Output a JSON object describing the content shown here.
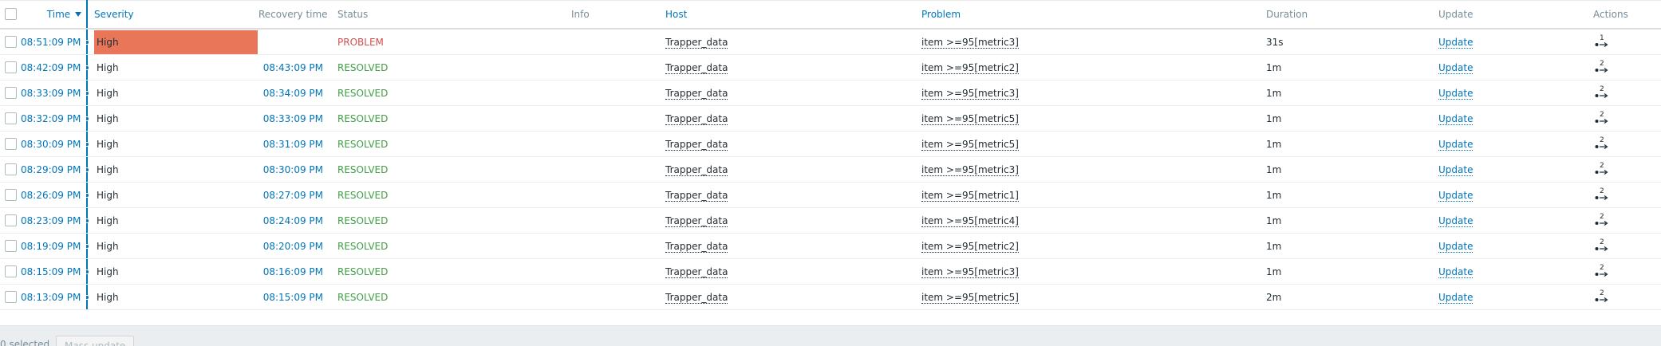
{
  "header": {
    "time": "Time",
    "time_sort_icon": "sort-desc-icon",
    "severity": "Severity",
    "recovery_time": "Recovery time",
    "status": "Status",
    "info": "Info",
    "host": "Host",
    "problem": "Problem",
    "duration": "Duration",
    "update": "Update",
    "actions": "Actions"
  },
  "colors": {
    "link": "#0275b8",
    "high_severity_bg": "#e97659",
    "problem_status": "#d64e4e",
    "resolved_status": "#429e47"
  },
  "rows": [
    {
      "time": "08:51:09 PM",
      "severity": "High",
      "severity_active": true,
      "recovery": "",
      "status": "PROBLEM",
      "host": "Trapper_data",
      "problem": "item >=95[metric3]",
      "duration": "31s",
      "update": "Update",
      "actions_count": "1"
    },
    {
      "time": "08:42:09 PM",
      "severity": "High",
      "severity_active": false,
      "recovery": "08:43:09 PM",
      "status": "RESOLVED",
      "host": "Trapper_data",
      "problem": "item >=95[metric2]",
      "duration": "1m",
      "update": "Update",
      "actions_count": "2"
    },
    {
      "time": "08:33:09 PM",
      "severity": "High",
      "severity_active": false,
      "recovery": "08:34:09 PM",
      "status": "RESOLVED",
      "host": "Trapper_data",
      "problem": "item >=95[metric3]",
      "duration": "1m",
      "update": "Update",
      "actions_count": "2"
    },
    {
      "time": "08:32:09 PM",
      "severity": "High",
      "severity_active": false,
      "recovery": "08:33:09 PM",
      "status": "RESOLVED",
      "host": "Trapper_data",
      "problem": "item >=95[metric5]",
      "duration": "1m",
      "update": "Update",
      "actions_count": "2"
    },
    {
      "time": "08:30:09 PM",
      "severity": "High",
      "severity_active": false,
      "recovery": "08:31:09 PM",
      "status": "RESOLVED",
      "host": "Trapper_data",
      "problem": "item >=95[metric5]",
      "duration": "1m",
      "update": "Update",
      "actions_count": "2"
    },
    {
      "time": "08:29:09 PM",
      "severity": "High",
      "severity_active": false,
      "recovery": "08:30:09 PM",
      "status": "RESOLVED",
      "host": "Trapper_data",
      "problem": "item >=95[metric3]",
      "duration": "1m",
      "update": "Update",
      "actions_count": "2"
    },
    {
      "time": "08:26:09 PM",
      "severity": "High",
      "severity_active": false,
      "recovery": "08:27:09 PM",
      "status": "RESOLVED",
      "host": "Trapper_data",
      "problem": "item >=95[metric1]",
      "duration": "1m",
      "update": "Update",
      "actions_count": "2"
    },
    {
      "time": "08:23:09 PM",
      "severity": "High",
      "severity_active": false,
      "recovery": "08:24:09 PM",
      "status": "RESOLVED",
      "host": "Trapper_data",
      "problem": "item >=95[metric4]",
      "duration": "1m",
      "update": "Update",
      "actions_count": "2"
    },
    {
      "time": "08:19:09 PM",
      "severity": "High",
      "severity_active": false,
      "recovery": "08:20:09 PM",
      "status": "RESOLVED",
      "host": "Trapper_data",
      "problem": "item >=95[metric2]",
      "duration": "1m",
      "update": "Update",
      "actions_count": "2"
    },
    {
      "time": "08:15:09 PM",
      "severity": "High",
      "severity_active": false,
      "recovery": "08:16:09 PM",
      "status": "RESOLVED",
      "host": "Trapper_data",
      "problem": "item >=95[metric3]",
      "duration": "1m",
      "update": "Update",
      "actions_count": "2"
    },
    {
      "time": "08:13:09 PM",
      "severity": "High",
      "severity_active": false,
      "recovery": "08:15:09 PM",
      "status": "RESOLVED",
      "host": "Trapper_data",
      "problem": "item >=95[metric5]",
      "duration": "2m",
      "update": "Update",
      "actions_count": "2"
    }
  ],
  "footer": {
    "selected_count": "0 selected",
    "mass_update": "Mass update"
  }
}
